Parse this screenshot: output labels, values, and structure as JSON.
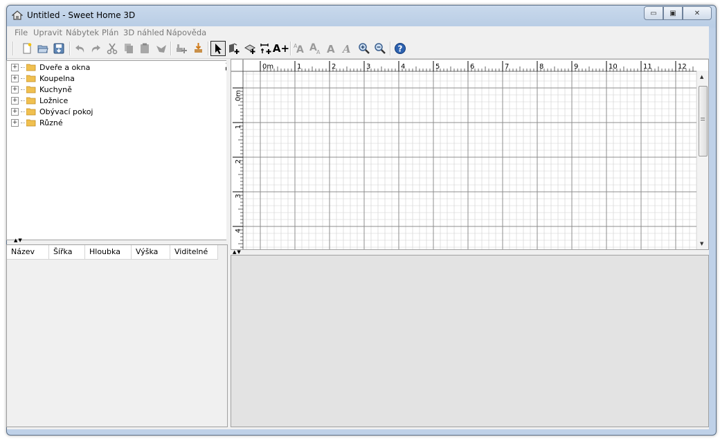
{
  "window": {
    "title": "Untitled - Sweet Home 3D"
  },
  "window_controls": {
    "minimize": "▭",
    "restore": "▣",
    "close": "✕"
  },
  "menu": [
    "File",
    "Upravit",
    "Nábytek",
    "Plán",
    "3D náhled",
    "Nápověda"
  ],
  "toolbar": {
    "icons": [
      "new-home-icon",
      "open-icon",
      "save-icon",
      "undo-icon",
      "redo-icon",
      "cut-icon",
      "copy-icon",
      "paste-icon",
      "delete-icon",
      "add-furniture-icon",
      "import-furniture-icon",
      "select-mode-icon",
      "create-walls-icon",
      "create-rooms-icon",
      "create-dimensions-icon",
      "add-text-icon",
      "increase-text-icon",
      "decrease-text-icon",
      "bold-text-icon",
      "italic-text-icon",
      "zoom-in-icon",
      "zoom-out-icon",
      "help-icon"
    ],
    "add_text_label": "A+"
  },
  "catalog": {
    "categories": [
      {
        "label": "Dveře a okna"
      },
      {
        "label": "Koupelna"
      },
      {
        "label": "Kuchyně"
      },
      {
        "label": "Ložnice"
      },
      {
        "label": "Obývací pokoj"
      },
      {
        "label": "Různé"
      }
    ]
  },
  "furniture_table": {
    "columns": [
      "Název",
      "Šířka",
      "Hloubka",
      "Výška",
      "Viditelné"
    ]
  },
  "plan": {
    "x_ticks": [
      "0m",
      "1",
      "2",
      "3",
      "4",
      "5",
      "6",
      "7",
      "8",
      "9",
      "10",
      "11",
      "12"
    ],
    "y_ticks": [
      "0m",
      "1",
      "2",
      "3",
      "4"
    ]
  },
  "colors": {
    "grid_major": "#8c8c8c",
    "grid_minor": "#cfcfcf",
    "view3d_bg": "#e3e3e3"
  }
}
